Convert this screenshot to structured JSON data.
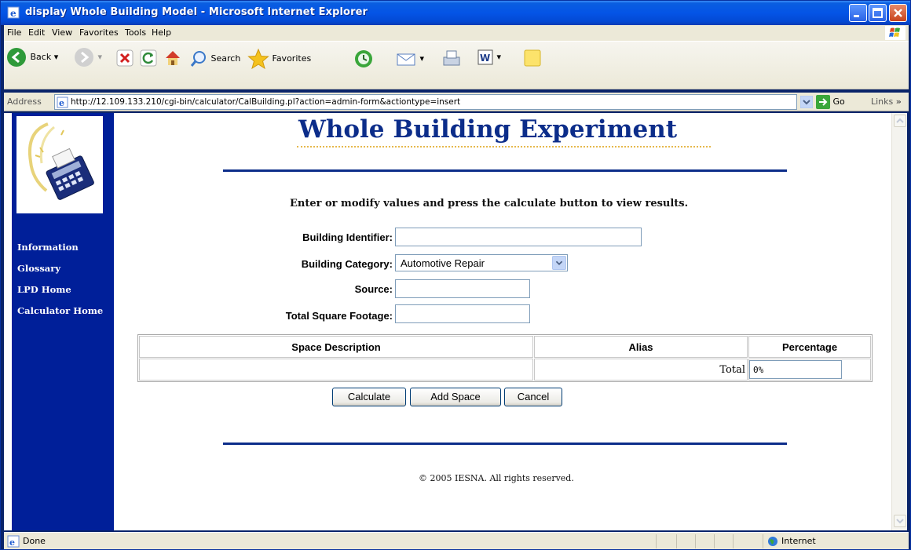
{
  "window": {
    "title": "display Whole Building Model - Microsoft Internet Explorer"
  },
  "menu": [
    "File",
    "Edit",
    "View",
    "Favorites",
    "Tools",
    "Help"
  ],
  "toolbar": {
    "back": "Back",
    "search": "Search",
    "favorites": "Favorites"
  },
  "address": {
    "label": "Address",
    "url": "http://12.109.133.210/cgi-bin/calculator/CalBuilding.pl?action=admin-form&actiontype=insert",
    "go": "Go",
    "links": "Links"
  },
  "sidebar": {
    "nav": [
      "Information",
      "Glossary",
      "LPD Home",
      "Calculator Home"
    ]
  },
  "page": {
    "title": "Whole Building Experiment",
    "instruction": "Enter or modify values and press the calculate button to view results.",
    "copyright": "© 2005 IESNA. All rights reserved."
  },
  "form": {
    "building_identifier_label": "Building Identifier:",
    "building_identifier_value": "",
    "building_category_label": "Building Category:",
    "building_category_value": "Automotive Repair",
    "source_label": "Source:",
    "source_value": "",
    "total_sqft_label": "Total Square Footage:",
    "total_sqft_value": ""
  },
  "table": {
    "headers": [
      "Space Description",
      "Alias",
      "Percentage"
    ],
    "total_label": "Total",
    "total_value": "0%"
  },
  "buttons": {
    "calculate": "Calculate",
    "add_space": "Add Space",
    "cancel": "Cancel"
  },
  "status": {
    "text": "Done",
    "zone": "Internet"
  }
}
